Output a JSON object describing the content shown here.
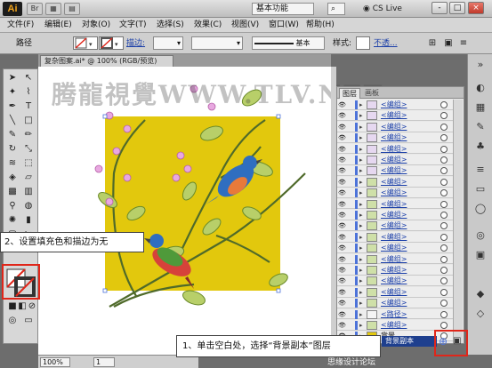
{
  "app": {
    "logo": "Ai",
    "workspace": "基本功能",
    "cs_live": "CS Live",
    "window_buttons": [
      "-",
      "□",
      "×"
    ]
  },
  "titlebar_buttons": [
    "Br",
    "",
    ""
  ],
  "menu": [
    "文件(F)",
    "编辑(E)",
    "对象(O)",
    "文字(T)",
    "选择(S)",
    "效果(C)",
    "视图(V)",
    "窗口(W)",
    "帮助(H)"
  ],
  "control_bar": {
    "path_label": "路径",
    "stroke_label": "描边:",
    "stroke_style": "基本",
    "style_label": "样式:",
    "opacity_label": "不透..."
  },
  "document_tab": "复杂图案.ai* @ 100% (RGB/预览)",
  "watermark": "腾龍視覺WWW.TLV.NET",
  "status_bar": {
    "zoom": "100%",
    "page": "1"
  },
  "layers_panel": {
    "tabs": [
      "图层",
      "画板"
    ],
    "rows": [
      {
        "name": "<编组>",
        "thumb_color": "#e6d8f0"
      },
      {
        "name": "<编组>",
        "thumb_color": "#e6d8f0"
      },
      {
        "name": "<编组>",
        "thumb_color": "#e6d8f0"
      },
      {
        "name": "<编组>",
        "thumb_color": "#e6d8f0"
      },
      {
        "name": "<编组>",
        "thumb_color": "#e6d8f0"
      },
      {
        "name": "<编组>",
        "thumb_color": "#e6d8f0"
      },
      {
        "name": "<编组>",
        "thumb_color": "#e6d8f0"
      },
      {
        "name": "<编组>",
        "thumb_color": "#cfe0a8"
      },
      {
        "name": "<编组>",
        "thumb_color": "#cfe0a8"
      },
      {
        "name": "<编组>",
        "thumb_color": "#cfe0a8"
      },
      {
        "name": "<编组>",
        "thumb_color": "#cfe0a8"
      },
      {
        "name": "<编组>",
        "thumb_color": "#cfe0a8"
      },
      {
        "name": "<编组>",
        "thumb_color": "#cfe0a8"
      },
      {
        "name": "<编组>",
        "thumb_color": "#cfe0a8"
      },
      {
        "name": "<编组>",
        "thumb_color": "#cfe0a8"
      },
      {
        "name": "<编组>",
        "thumb_color": "#cfe0a8"
      },
      {
        "name": "<编组>",
        "thumb_color": "#cfe0a8"
      },
      {
        "name": "<编组>",
        "thumb_color": "#cfe0a8"
      },
      {
        "name": "<编组>",
        "thumb_color": "#cfe0a8"
      },
      {
        "name": "<路径>",
        "thumb_color": "#f4f4f4"
      },
      {
        "name": "<编组>",
        "thumb_color": "#cfe0a8"
      },
      {
        "name": "背景",
        "thumb_color": "#e2c80d"
      }
    ]
  },
  "annotations": {
    "step2": "2、设置填充色和描边为无",
    "step1": "1、单击空白处，选择“背景副本”图层",
    "bg_copy_layer": "背景副本"
  },
  "footer": "思缘设计论坛",
  "colors": {
    "artwork_bg": "#e2c80d",
    "highlight": "#e0261a",
    "selected_row": "#1e3f8e",
    "link": "#1a3ea8"
  }
}
